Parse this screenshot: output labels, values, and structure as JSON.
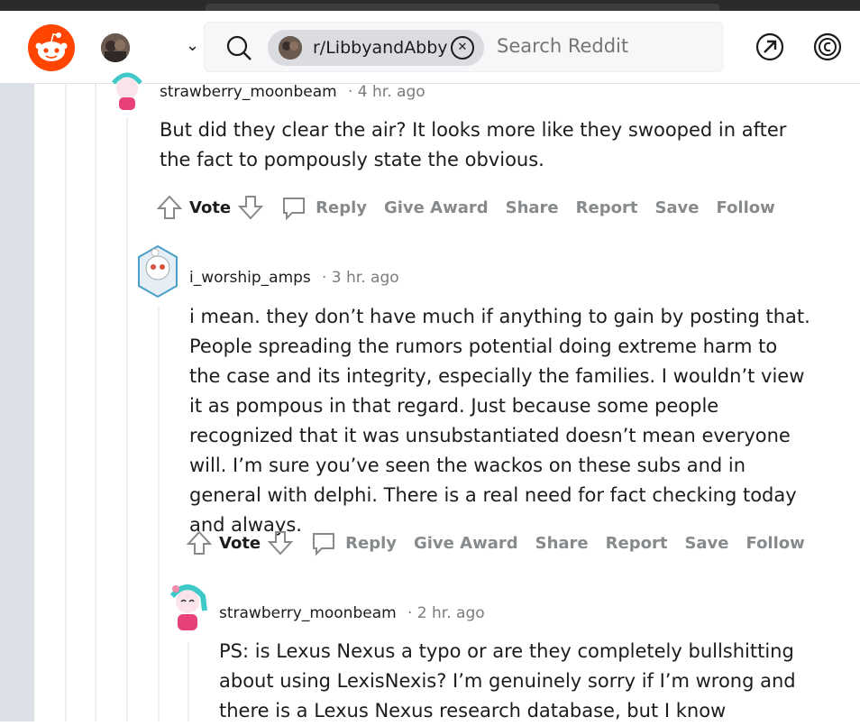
{
  "header": {
    "subreddit_chip": "r/LibbyandAbby",
    "search_placeholder": "Search Reddit",
    "chip_close": "⊗"
  },
  "colors": {
    "brand": "#ff4500",
    "muted": "#878a8c",
    "text": "#1c1c1c",
    "rail": "#dae0e6"
  },
  "comments": [
    {
      "user": "strawberry_moonbeam",
      "time": "· 4 hr. ago",
      "body": "But did they clear the air? It looks more like they swooped in after the fact to pompously state the obvious.",
      "actions": {
        "vote": "Vote",
        "reply": "Reply",
        "award": "Give Award",
        "share": "Share",
        "report": "Report",
        "save": "Save",
        "follow": "Follow"
      }
    },
    {
      "user": "i_worship_amps",
      "time": "· 3 hr. ago",
      "body": "i mean. they don’t have much if anything to gain by posting that. People spreading the rumors potential doing extreme harm to the case and its integrity, especially the families. I wouldn’t view it as pompous in that regard. Just because some people recognized that it was unsubstantiated doesn’t mean everyone will. I’m sure you’ve seen the wackos on these subs and in general with delphi. There is a real need for fact checking today and always.",
      "actions": {
        "vote": "Vote",
        "reply": "Reply",
        "award": "Give Award",
        "share": "Share",
        "report": "Report",
        "save": "Save",
        "follow": "Follow"
      }
    },
    {
      "user": "strawberry_moonbeam",
      "time": "· 2 hr. ago",
      "body": "PS: is Lexus Nexus a typo or are they completely bullshitting about using LexisNexis? I’m genuinely sorry if I’m wrong and there is a Lexus Nexus research database, but I know"
    }
  ]
}
